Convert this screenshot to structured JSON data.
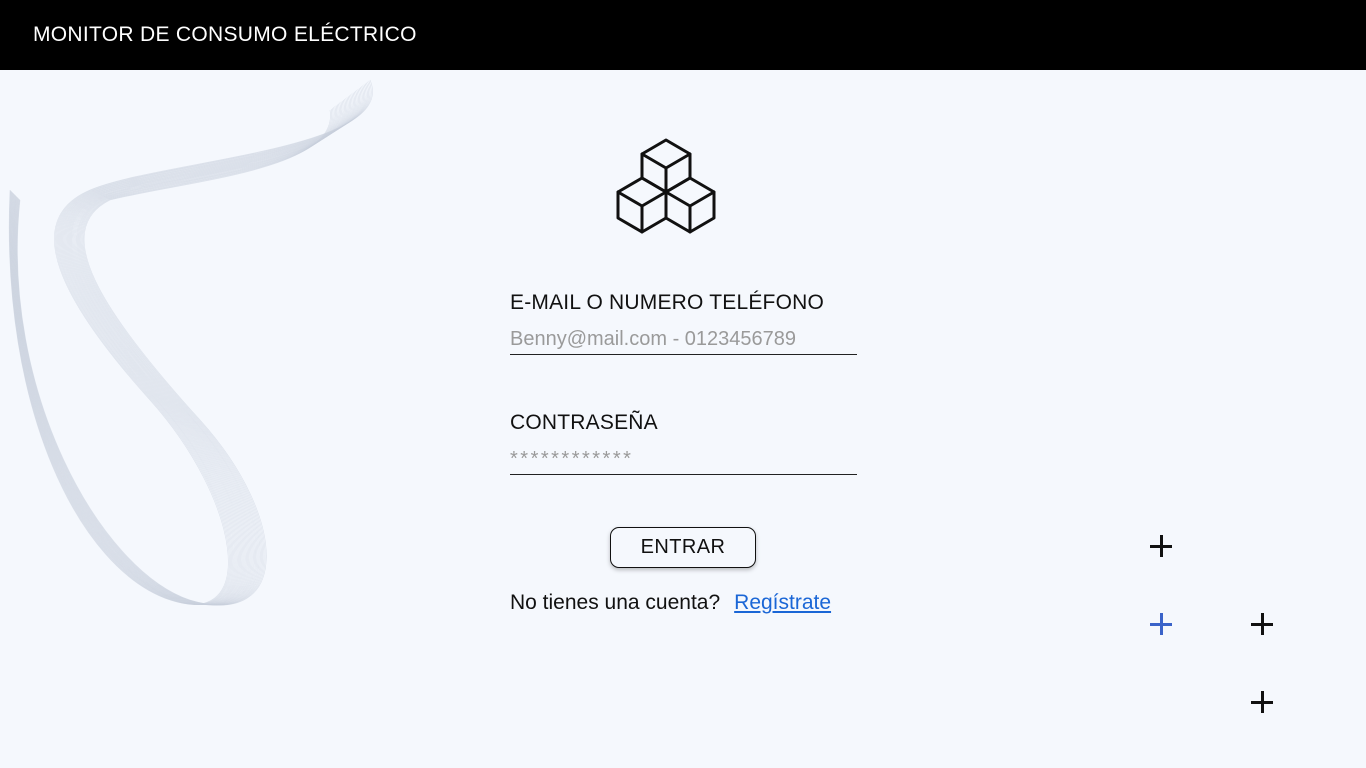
{
  "header": {
    "title": "MONITOR DE CONSUMO ELÉCTRICO"
  },
  "logo": {
    "icon": "cubes-icon"
  },
  "form": {
    "email_label": "E-MAIL O NUMERO TELÉFONO",
    "email_placeholder": "Benny@mail.com - 0123456789",
    "password_label": "CONTRASEÑA",
    "password_placeholder": "************",
    "submit_label": "ENTRAR"
  },
  "signup": {
    "prompt": "No tienes una cuenta?",
    "link_label": "Regístrate"
  },
  "decorations": {
    "plus_icons": [
      {
        "name": "plus-icon",
        "color": "#111111"
      },
      {
        "name": "plus-icon",
        "color": "#3a63c9"
      },
      {
        "name": "plus-icon",
        "color": "#111111"
      },
      {
        "name": "plus-icon",
        "color": "#111111"
      }
    ]
  },
  "colors": {
    "background": "#f5f8fd",
    "topbar": "#000000",
    "link": "#1a66d6",
    "accent_plus": "#3a63c9"
  }
}
